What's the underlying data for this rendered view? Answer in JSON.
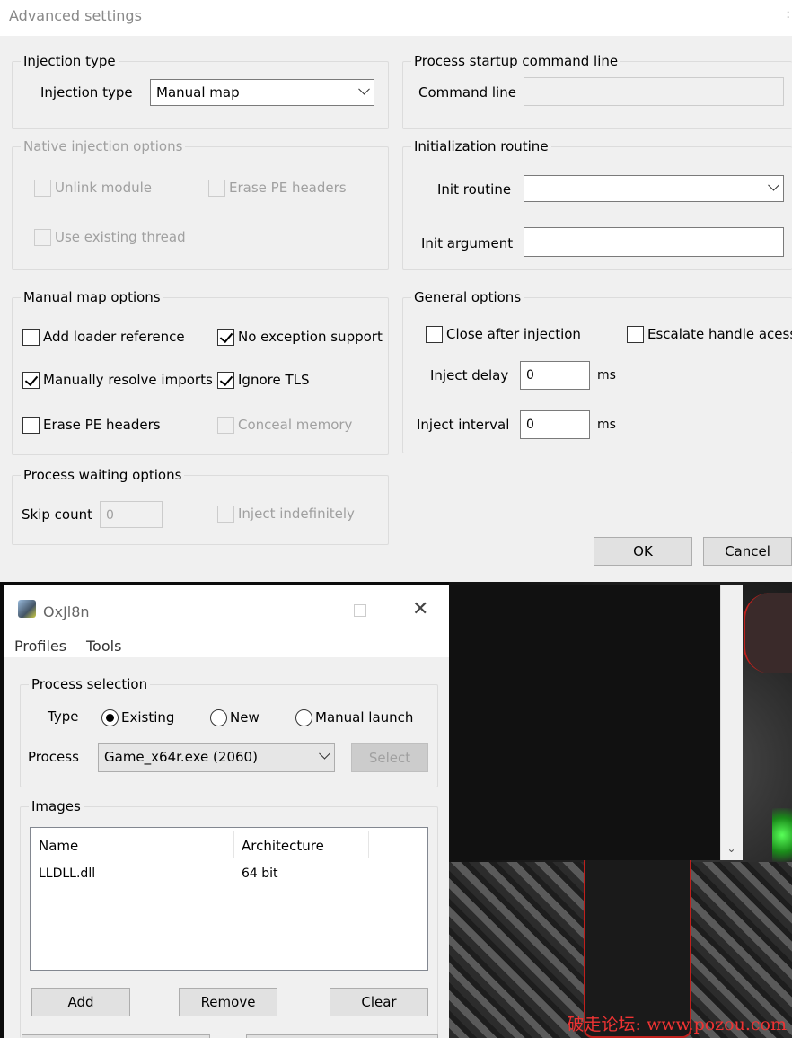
{
  "advanced": {
    "title": "Advanced settings",
    "close_glyph": ":",
    "injection_type_group": "Injection type",
    "injection_type_label": "Injection type",
    "injection_type_value": "Manual map",
    "startup_group": "Process startup command line",
    "command_line_label": "Command line",
    "command_line_value": "",
    "native_group": "Native injection options",
    "unlink_module": "Unlink module",
    "erase_pe_headers_native": "Erase PE headers",
    "use_existing_thread": "Use existing thread",
    "init_group": "Initialization routine",
    "init_routine_label": "Init routine",
    "init_routine_value": "",
    "init_argument_label": "Init argument",
    "init_argument_value": "",
    "manual_group": "Manual map options",
    "add_loader_reference": "Add loader reference",
    "no_exception_support": "No exception support",
    "manually_resolve_imports": "Manually resolve imports",
    "ignore_tls": "Ignore TLS",
    "erase_pe_headers_manual": "Erase PE headers",
    "conceal_memory": "Conceal memory",
    "general_group": "General options",
    "close_after_injection": "Close after injection",
    "escalate_handle_access": "Escalate handle acess",
    "inject_delay_label": "Inject delay",
    "inject_delay_value": "0",
    "inject_interval_label": "Inject interval",
    "inject_interval_value": "0",
    "ms_unit": "ms",
    "waiting_group": "Process waiting options",
    "skip_count_label": "Skip count",
    "skip_count_value": "0",
    "inject_indefinitely": "Inject indefinitely",
    "ok_label": "OK",
    "cancel_label": "Cancel",
    "checked": {
      "unlink_module": false,
      "erase_pe_headers_native": false,
      "use_existing_thread": false,
      "add_loader_reference": false,
      "no_exception_support": true,
      "manually_resolve_imports": true,
      "ignore_tls": true,
      "erase_pe_headers_manual": false,
      "conceal_memory": false,
      "close_after_injection": false,
      "escalate_handle_access": false,
      "inject_indefinitely": false
    }
  },
  "injector": {
    "title": "OxJl8n",
    "menu": [
      "Profiles",
      "Tools"
    ],
    "process_selection_group": "Process selection",
    "type_label": "Type",
    "type_options": [
      "Existing",
      "New",
      "Manual launch"
    ],
    "type_selected": "Existing",
    "process_label": "Process",
    "process_value": "Game_x64r.exe (2060)",
    "select_label": "Select",
    "images_group": "Images",
    "columns": [
      "Name",
      "Architecture"
    ],
    "rows": [
      {
        "name": "LLDLL.dll",
        "arch": "64 bit"
      }
    ],
    "add_label": "Add",
    "remove_label": "Remove",
    "clear_label": "Clear"
  },
  "watermark": "破走论坛: www.pozou.com",
  "colors": {
    "dialog_bg": "#f0f0f0",
    "disabled_text": "#a0a0a0",
    "watermark": "#ee3333",
    "outline_red": "#c0201c"
  }
}
